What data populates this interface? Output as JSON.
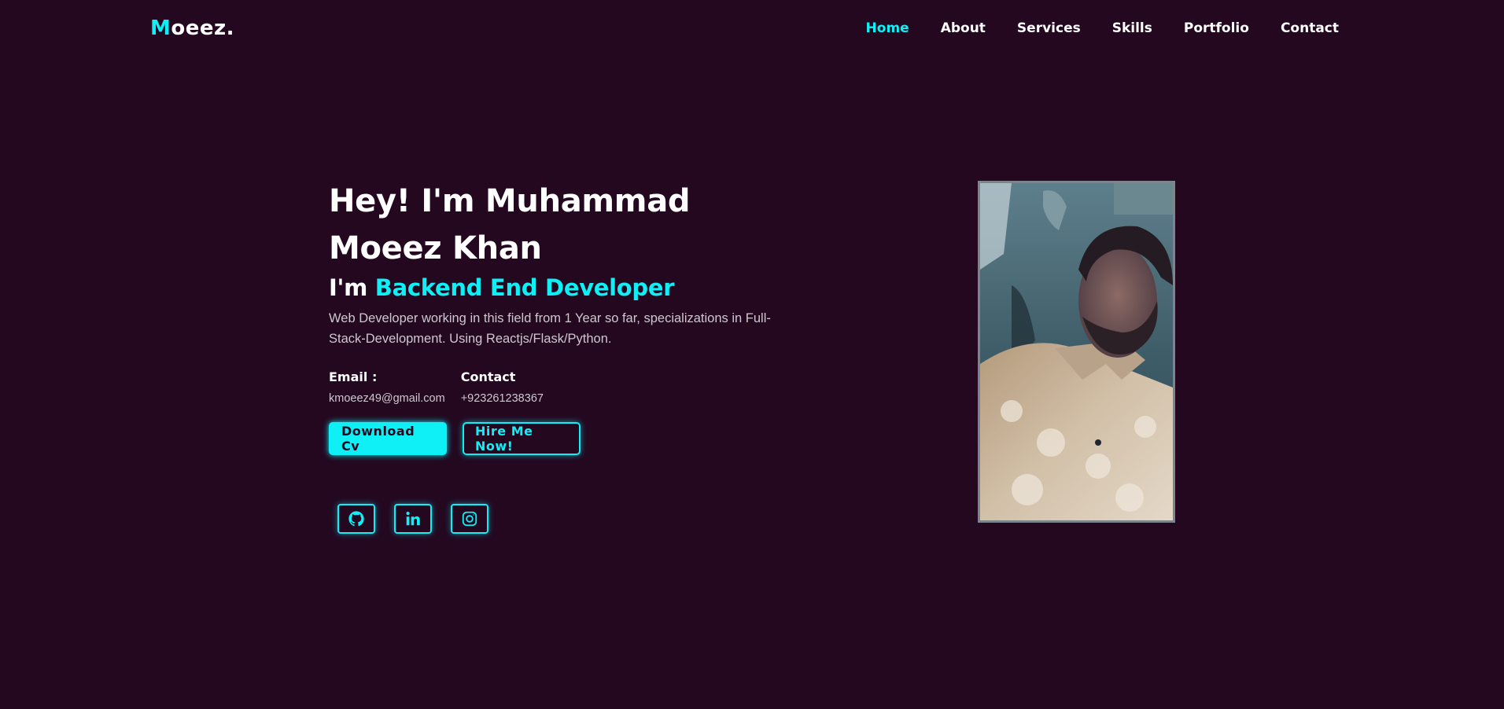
{
  "header": {
    "logo_initial": "M",
    "logo_rest": "oeez.",
    "nav": [
      {
        "label": "Home",
        "active": true
      },
      {
        "label": "About",
        "active": false
      },
      {
        "label": "Services",
        "active": false
      },
      {
        "label": "Skills",
        "active": false
      },
      {
        "label": "Portfolio",
        "active": false
      },
      {
        "label": "Contact",
        "active": false
      }
    ]
  },
  "hero": {
    "title": "Hey! I'm Muhammad Moeez Khan",
    "subtitle_prefix": "I'm ",
    "subtitle_role": "Backend End Developer",
    "description": "Web Developer working in this field from 1 Year so far, specializations in Full-Stack-Development. Using Reactjs/Flask/Python.",
    "email_label": "Email :",
    "email_value": "kmoeez49@gmail.com",
    "contact_label": "Contact",
    "contact_value": "+923261238367",
    "download_button": "Download Cv",
    "hire_button": "Hire Me Now!"
  },
  "socials": [
    {
      "icon": "github-icon"
    },
    {
      "icon": "linkedin-icon"
    },
    {
      "icon": "instagram-icon"
    }
  ],
  "colors": {
    "background": "#230820",
    "accent": "#0ef0f5",
    "text": "#ffffff",
    "muted_text": "#cfc7d0"
  }
}
